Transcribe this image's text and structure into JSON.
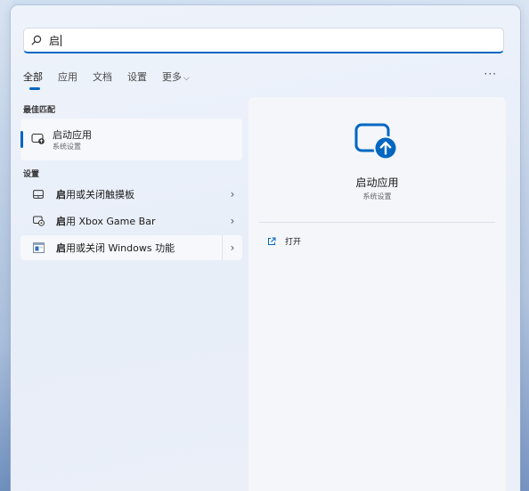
{
  "search": {
    "query": "启"
  },
  "tabs": [
    {
      "label": "全部"
    },
    {
      "label": "应用"
    },
    {
      "label": "文档"
    },
    {
      "label": "设置"
    },
    {
      "label": "更多"
    }
  ],
  "more_menu": "···",
  "best_match": {
    "section": "最佳匹配",
    "title": "启动应用",
    "subtitle": "系统设置"
  },
  "settings": {
    "section": "设置",
    "items": [
      {
        "bold": "启",
        "rest": "用或关闭触摸板",
        "chevron": "›"
      },
      {
        "bold": "启",
        "rest": "用 Xbox Game Bar",
        "chevron": "›"
      },
      {
        "bold": "启",
        "rest": "用或关闭 Windows 功能",
        "chevron": "›"
      }
    ]
  },
  "detail": {
    "title": "启动应用",
    "subtitle": "系统设置",
    "open_label": "打开"
  },
  "colors": {
    "accent": "#0067c0"
  }
}
